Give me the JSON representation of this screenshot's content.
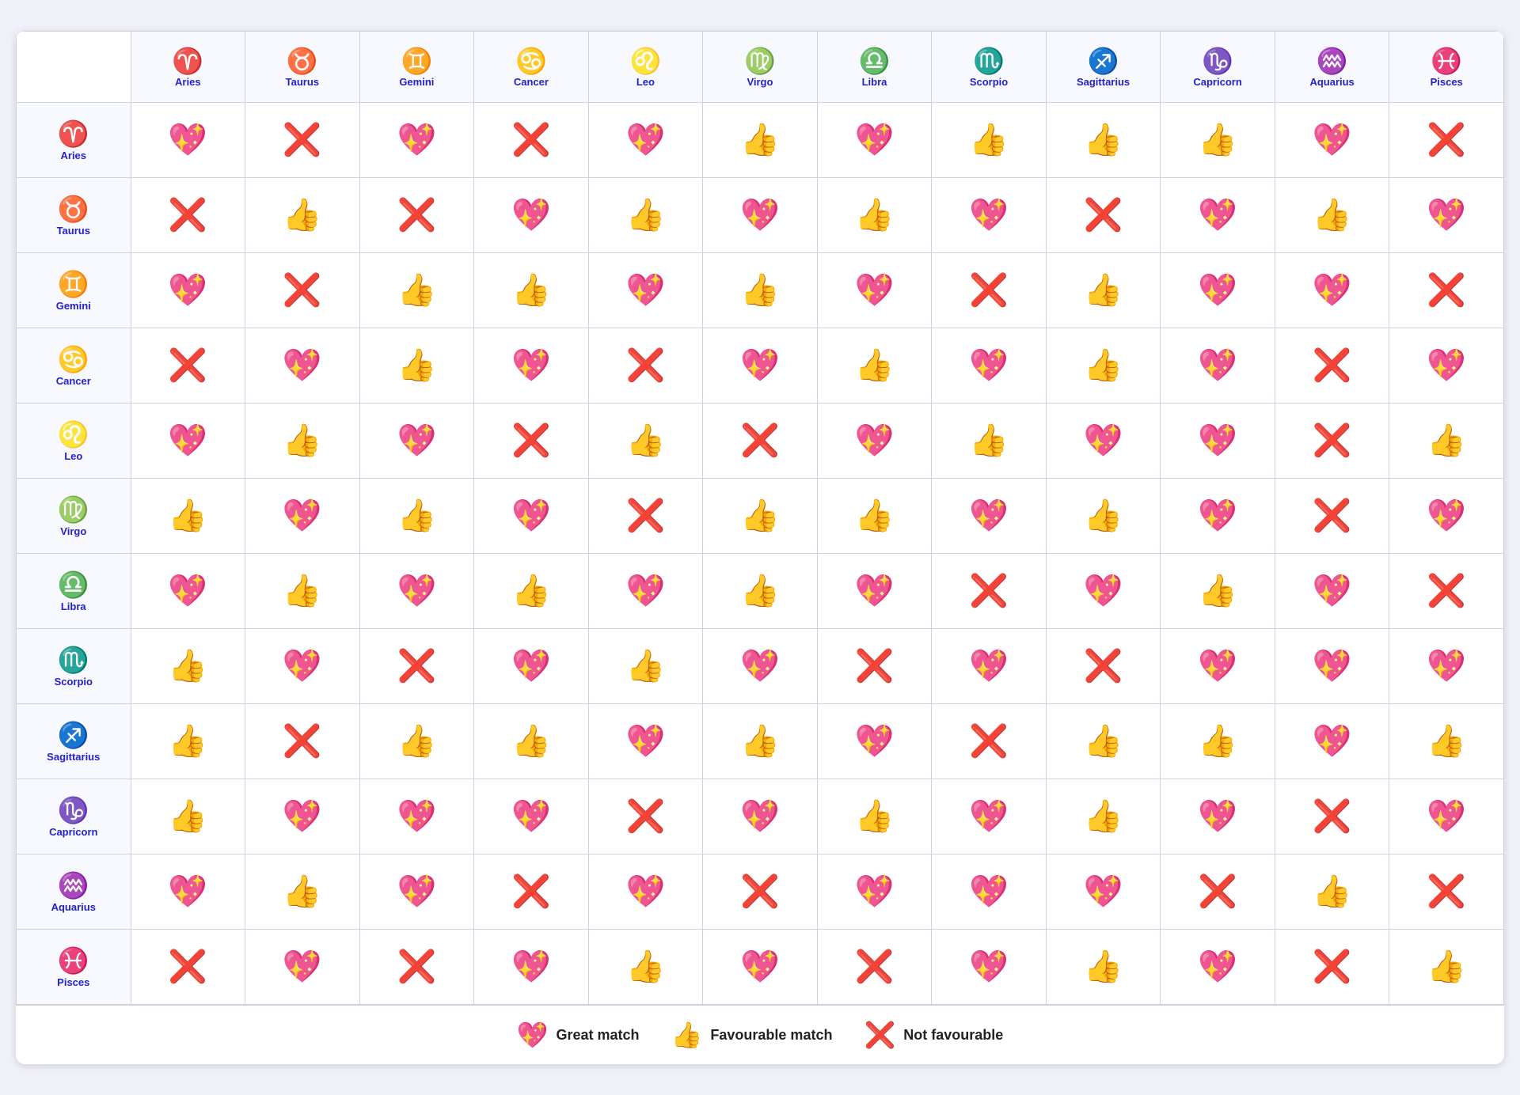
{
  "signs": [
    {
      "name": "Aries",
      "symbol": "♈"
    },
    {
      "name": "Taurus",
      "symbol": "♉"
    },
    {
      "name": "Gemini",
      "symbol": "♊"
    },
    {
      "name": "Cancer",
      "symbol": "♋"
    },
    {
      "name": "Leo",
      "symbol": "♌"
    },
    {
      "name": "Virgo",
      "symbol": "♍"
    },
    {
      "name": "Libra",
      "symbol": "♎"
    },
    {
      "name": "Scorpio",
      "symbol": "♏"
    },
    {
      "name": "Sagittarius",
      "symbol": "♐"
    },
    {
      "name": "Capricorn",
      "symbol": "♑"
    },
    {
      "name": "Aquarius",
      "symbol": "♒"
    },
    {
      "name": "Pisces",
      "symbol": "♓"
    }
  ],
  "emojis": {
    "heart": "💖",
    "thumb": "👍",
    "cross": "❌"
  },
  "H": "💖",
  "T": "👍",
  "X": "❌",
  "matrix": [
    [
      "H",
      "X",
      "H",
      "X",
      "H",
      "T",
      "H",
      "T",
      "T",
      "T",
      "H",
      "X"
    ],
    [
      "X",
      "T",
      "X",
      "H",
      "T",
      "H",
      "T",
      "H",
      "X",
      "H",
      "T",
      "H"
    ],
    [
      "H",
      "X",
      "T",
      "T",
      "H",
      "T",
      "H",
      "X",
      "T",
      "H",
      "H",
      "X"
    ],
    [
      "X",
      "H",
      "T",
      "H",
      "X",
      "H",
      "T",
      "H",
      "T",
      "H",
      "X",
      "H"
    ],
    [
      "H",
      "T",
      "H",
      "X",
      "T",
      "X",
      "H",
      "T",
      "H",
      "H",
      "X",
      "T"
    ],
    [
      "T",
      "H",
      "T",
      "H",
      "X",
      "T",
      "T",
      "H",
      "T",
      "H",
      "X",
      "H"
    ],
    [
      "H",
      "T",
      "H",
      "T",
      "H",
      "T",
      "H",
      "X",
      "H",
      "T",
      "H",
      "X"
    ],
    [
      "T",
      "H",
      "X",
      "H",
      "T",
      "H",
      "X",
      "H",
      "X",
      "H",
      "H",
      "H"
    ],
    [
      "T",
      "X",
      "T",
      "T",
      "H",
      "T",
      "H",
      "X",
      "T",
      "T",
      "H",
      "T"
    ],
    [
      "T",
      "H",
      "H",
      "H",
      "X",
      "H",
      "T",
      "H",
      "T",
      "H",
      "X",
      "H"
    ],
    [
      "H",
      "T",
      "H",
      "X",
      "H",
      "X",
      "H",
      "H",
      "H",
      "X",
      "T",
      "X"
    ],
    [
      "X",
      "H",
      "X",
      "H",
      "T",
      "H",
      "X",
      "H",
      "T",
      "H",
      "X",
      "T"
    ]
  ],
  "legend": {
    "great_match": "Great match",
    "favourable_match": "Favourable match",
    "not_favourable": "Not favourable"
  }
}
